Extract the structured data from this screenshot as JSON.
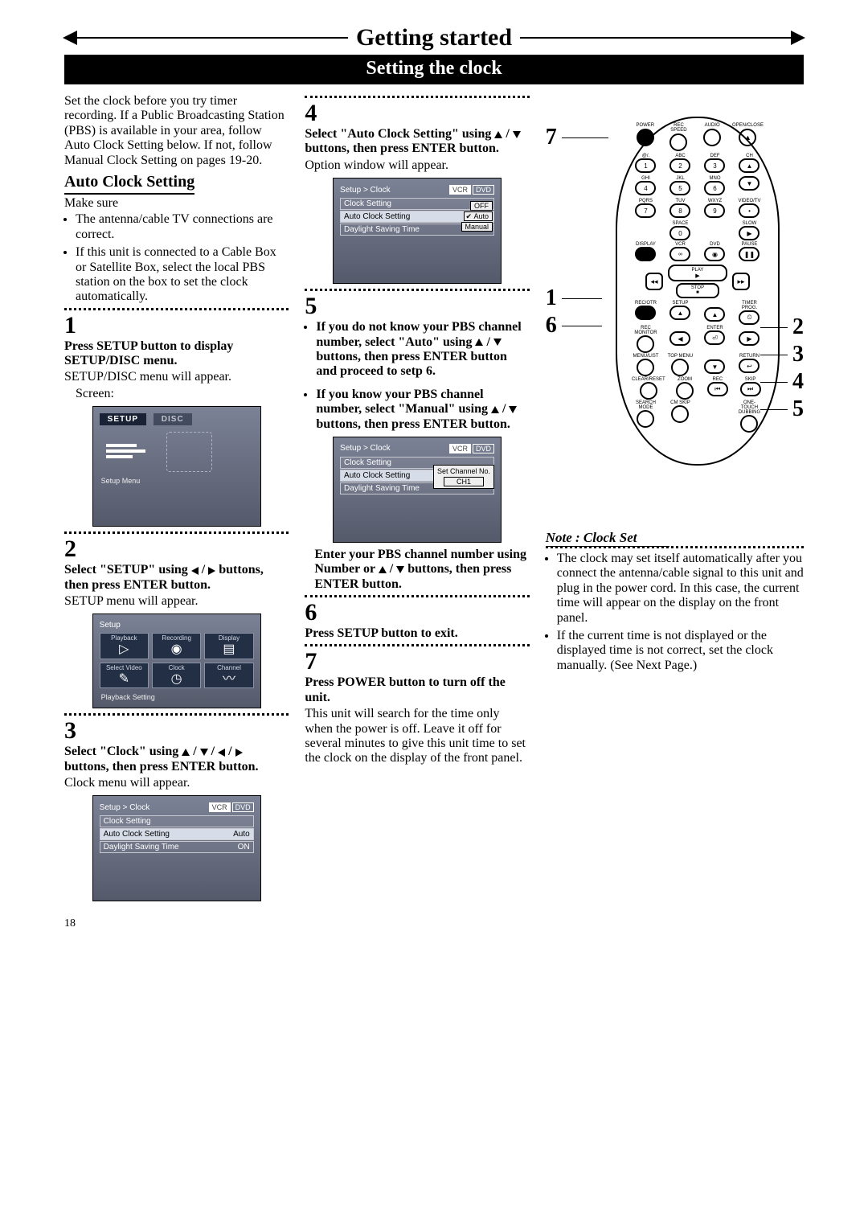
{
  "header": {
    "title": "Getting started",
    "subtitle": "Setting the clock"
  },
  "col1": {
    "intro": "Set the clock before you try timer recording. If a Public Broadcasting Station (PBS) is available in your area, follow Auto Clock Setting below. If not, follow Manual Clock Setting on pages 19-20.",
    "auto_heading": "Auto Clock Setting",
    "makesure": "Make sure",
    "ms1": "The antenna/cable TV connections are correct.",
    "ms2": "If this unit is connected to a Cable Box or Satellite Box, select the local PBS station on the box to set the clock automatically.",
    "s1": "1",
    "s1t": "Press SETUP button to display SETUP/DISC menu.",
    "s1b": "SETUP/DISC menu will appear.",
    "s1c": "Screen:",
    "osd1": {
      "tab_setup": "SETUP",
      "tab_disc": "DISC",
      "foot": "Setup Menu"
    },
    "s2": "2",
    "s2t_a": "Select \"SETUP\" using ",
    "s2t_b": " buttons, then press ENTER button.",
    "s2b": "SETUP menu will appear.",
    "osd2": {
      "crumb": "Setup",
      "cells": [
        "Playback",
        "Recording",
        "Display",
        "Select Video",
        "Clock",
        "Channel"
      ],
      "foot": "Playback Setting"
    },
    "s3": "3",
    "s3t_a": "Select \"Clock\" using ",
    "s3t_b": " buttons, then press ENTER button.",
    "s3b": "Clock menu will appear.",
    "osd3": {
      "crumb": "Setup > Clock",
      "vcr": "VCR",
      "dvd": "DVD",
      "r1": "Clock Setting",
      "r2": "Auto Clock Setting",
      "r2v": "Auto",
      "r3": "Daylight Saving Time",
      "r3v": "ON"
    }
  },
  "col2": {
    "s4": "4",
    "s4t_a": "Select \"Auto Clock Setting\" using ",
    "s4t_b": " buttons, then press ENTER button.",
    "s4b": "Option window will appear.",
    "osd4": {
      "crumb": "Setup > Clock",
      "vcr": "VCR",
      "dvd": "DVD",
      "r1": "Clock Setting",
      "r2": "Auto Clock Setting",
      "r3": "Daylight Saving Time",
      "opt1": "OFF",
      "opt2": "Auto",
      "opt3": "Manual",
      "check": "✔"
    },
    "s5": "5",
    "s5a_a": "If you do not know your PBS channel number, select \"Auto\" using ",
    "s5a_b": " buttons, then press ENTER button and proceed to setp 6.",
    "s5b_a": "If you know your PBS channel number, select \"Manual\" using ",
    "s5b_b": " buttons, then press ENTER button.",
    "osd5": {
      "crumb": "Setup > Clock",
      "vcr": "VCR",
      "dvd": "DVD",
      "r1": "Clock Setting",
      "r2": "Auto Clock Setting",
      "r3": "Daylight Saving Time",
      "pop1": "Set Channel No.",
      "pop2": "CH1"
    },
    "s5c_a": "Enter your PBS channel number using Number or ",
    "s5c_b": " buttons, then press ENTER button.",
    "s6": "6",
    "s6t": "Press SETUP button to exit.",
    "s7": "7",
    "s7t": "Press POWER button to turn off the unit.",
    "s7b": "This unit will search for the time only when the power is off. Leave it off for several minutes to give this unit time to set the clock on the display of the front panel."
  },
  "col3": {
    "callouts": {
      "n1": "1",
      "n2": "2",
      "n3": "3",
      "n4": "4",
      "n5": "5",
      "n6": "6",
      "n7": "7"
    },
    "remote": {
      "row1": [
        "POWER",
        "REC SPEED",
        "AUDIO",
        "OPEN/CLOSE"
      ],
      "num_rows": [
        [
          "@/.",
          "ABC",
          "DEF",
          ""
        ],
        [
          "1",
          "2",
          "3",
          "CH ▲"
        ],
        [
          "GHI",
          "JKL",
          "MNO",
          ""
        ],
        [
          "4",
          "5",
          "6",
          "CH ▼"
        ],
        [
          "PQRS",
          "TUV",
          "WXYZ",
          "VIDEO/TV"
        ],
        [
          "7",
          "8",
          "9",
          "•"
        ],
        [
          "",
          "SPACE",
          "",
          "SLOW"
        ],
        [
          "",
          "0",
          "",
          "▶"
        ]
      ],
      "row_mode": [
        "DISPLAY",
        "VCR",
        "DVD",
        "PAUSE"
      ],
      "play": "PLAY",
      "stop": "STOP",
      "row_setup": [
        "REC/OTR",
        "SETUP",
        "",
        "TIMER PROG."
      ],
      "row_enter": [
        "REC MONITOR",
        "",
        "ENTER",
        ""
      ],
      "row_menu": [
        "MENU/LIST",
        "TOP MENU",
        "",
        "RETURN"
      ],
      "row_zoom": [
        "CLEAR/RESET",
        "ZOOM",
        "REC",
        "SKIP"
      ],
      "row_skip": [
        "SEARCH MODE",
        "CM SKIP",
        "",
        "ONE-TOUCH DUBBING"
      ]
    },
    "note_head": "Note : Clock Set",
    "note1": "The clock may set itself automatically after you connect the antenna/cable signal to this unit and plug in the power cord. In this case, the current time will appear on the display on the front panel.",
    "note2": "If the current time is not displayed or the displayed time is not correct, set the clock manually. (See Next Page.)"
  },
  "page_number": "18"
}
